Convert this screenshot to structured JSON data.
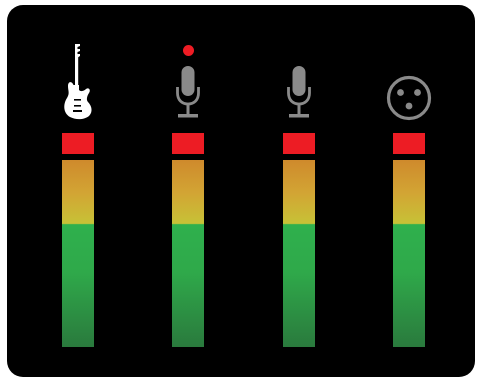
{
  "colors": {
    "panel_background": "#000000",
    "clip_indicator": "#ed1c24",
    "record_indicator": "#ee1c24",
    "icon_active": "#ffffff",
    "icon_inactive": "#8a8a8a"
  },
  "channels": [
    {
      "id": "guitar",
      "icon": "electric-guitar-icon",
      "icon_state": "active",
      "armed": false,
      "clipping": true,
      "level": 1.0
    },
    {
      "id": "mic-1",
      "icon": "microphone-icon",
      "icon_state": "inactive",
      "armed": true,
      "clipping": true,
      "level": 1.0
    },
    {
      "id": "mic-2",
      "icon": "microphone-icon",
      "icon_state": "inactive",
      "armed": false,
      "clipping": true,
      "level": 1.0
    },
    {
      "id": "xlr",
      "icon": "xlr-connector-icon",
      "icon_state": "inactive",
      "armed": false,
      "clipping": true,
      "level": 1.0
    }
  ]
}
